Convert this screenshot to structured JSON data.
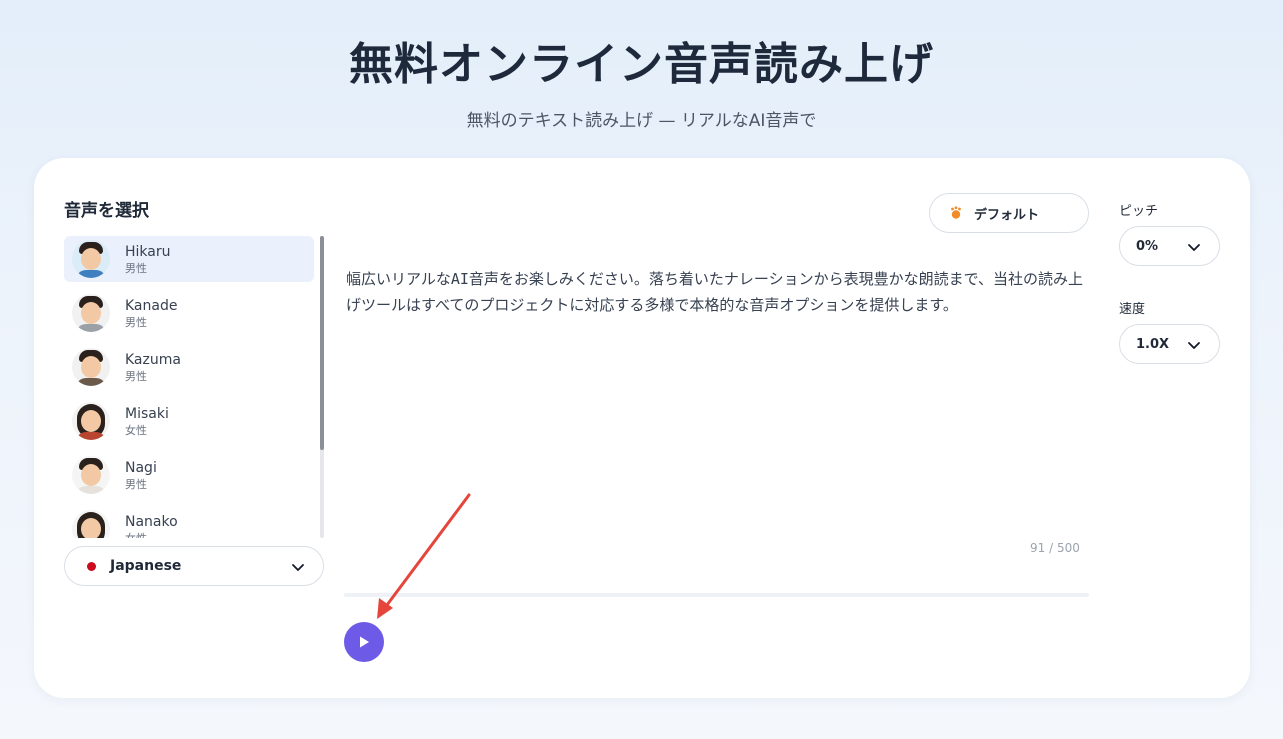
{
  "header": {
    "title": "無料オンライン音声読み上げ",
    "subtitle": "無料のテキスト読み上げ — リアルなAI音声で"
  },
  "voice_panel": {
    "heading": "音声を選択",
    "voices": [
      {
        "name": "Hikaru",
        "gender": "男性",
        "selected": true
      },
      {
        "name": "Kanade",
        "gender": "男性",
        "selected": false
      },
      {
        "name": "Kazuma",
        "gender": "男性",
        "selected": false
      },
      {
        "name": "Misaki",
        "gender": "女性",
        "selected": false
      },
      {
        "name": "Nagi",
        "gender": "男性",
        "selected": false
      },
      {
        "name": "Nanako",
        "gender": "女性",
        "selected": false
      }
    ],
    "language": {
      "label": "Japanese",
      "flag_icon": "japan-flag-icon"
    }
  },
  "editor": {
    "preset_label": "デフォルト",
    "text": "幅広いリアルなAI音声をお楽しみください。落ち着いたナレーションから表現豊かな朗読まで、当社の読み上げツールはすべてのプロジェクトに対応する多様で本格的な音声オプションを提供します。",
    "char_count": "91 / 500",
    "playback_progress": 0
  },
  "controls": {
    "pitch_label": "ピッチ",
    "pitch_value": "0%",
    "speed_label": "速度",
    "speed_value": "1.0X"
  },
  "colors": {
    "accent": "#6d5be8",
    "selected_bg": "#eaf1fc",
    "annotation_arrow": "#e5453a"
  }
}
